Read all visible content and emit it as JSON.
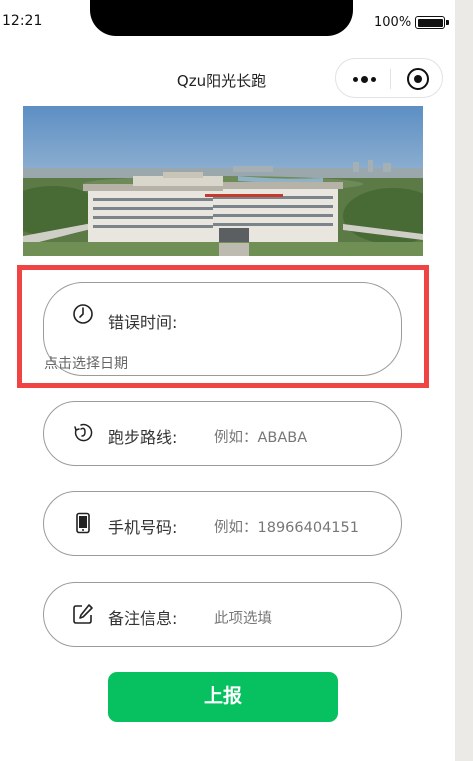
{
  "status_bar": {
    "time": "12:21",
    "battery": "100%"
  },
  "nav": {
    "title": "Qzu阳光长跑",
    "more_icon": "more-dots-icon",
    "close_icon": "target-icon"
  },
  "banner": {
    "alt": "campus-building-photo"
  },
  "form": {
    "error_time": {
      "label": "错误时间:",
      "hint": "点击选择日期",
      "icon": "clock-icon"
    },
    "route": {
      "label": "跑步路线:",
      "placeholder": "例如：ABABA",
      "icon": "route-icon"
    },
    "phone": {
      "label": "手机号码:",
      "placeholder": "例如：18966404151",
      "icon": "phone-icon"
    },
    "remark": {
      "label": "备注信息:",
      "placeholder": "此项选填",
      "icon": "edit-icon"
    }
  },
  "submit_label": "上报",
  "colors": {
    "accent": "#07c160",
    "highlight": "#f04343"
  }
}
